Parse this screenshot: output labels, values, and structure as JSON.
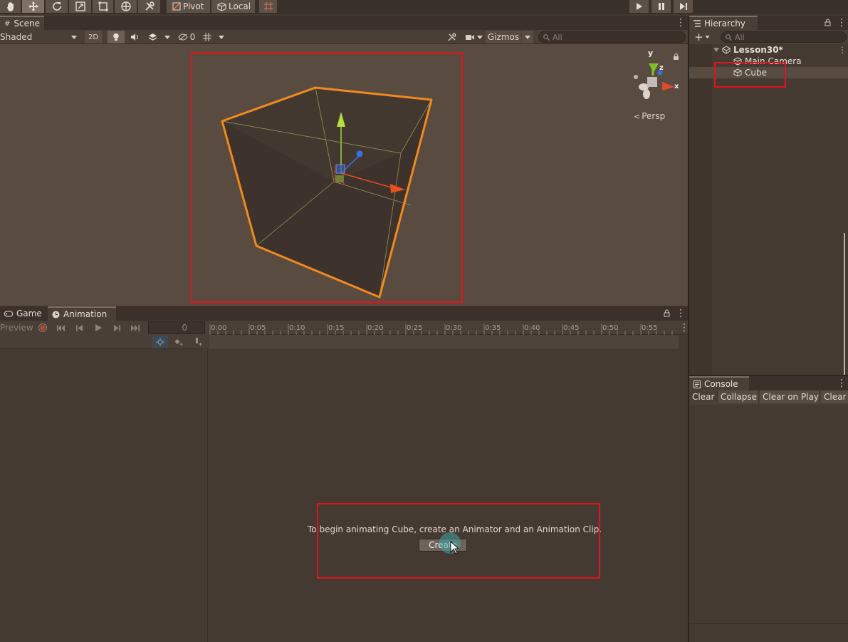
{
  "toolbar": {
    "tools": [
      "hand-tool",
      "move-tool",
      "rotate-tool",
      "scale-tool",
      "rect-tool",
      "transform-tool",
      "custom-tool"
    ],
    "pivot_label": "Pivot",
    "local_label": "Local",
    "play_controls": [
      "play",
      "pause",
      "step"
    ]
  },
  "scene": {
    "tab_label": "Scene",
    "shading_mode": "Shaded",
    "toggle_2d": "2D",
    "hidden_count": "0",
    "gizmos_label": "Gizmos",
    "search_placeholder": "All",
    "persp_label": "Persp",
    "axis_y": "y",
    "axis_z": "z",
    "axis_x": "x"
  },
  "animation": {
    "tab_game": "Game",
    "tab_animation": "Animation",
    "preview_label": "Preview",
    "frame_value": "0",
    "timeline_ticks": [
      "0:00",
      "0:05",
      "0:10",
      "0:15",
      "0:20",
      "0:25",
      "0:30",
      "0:35",
      "0:40",
      "0:45",
      "0:50",
      "0:55"
    ],
    "message": "To begin animating Cube, create an Animator and an Animation Clip.",
    "create_label": "Create"
  },
  "hierarchy": {
    "tab_label": "Hierarchy",
    "search_placeholder": "All",
    "scene_name": "Lesson30*",
    "items": [
      {
        "label": "Main Camera"
      },
      {
        "label": "Cube"
      }
    ]
  },
  "console": {
    "tab_label": "Console",
    "buttons": [
      "Clear",
      "Collapse",
      "Clear on Play",
      "Clear"
    ]
  },
  "colors": {
    "highlight_red": "#e0141c",
    "selection_orange": "#f08a1e",
    "scene_bg": "#5a4b40",
    "panel_bg": "#453a31"
  }
}
